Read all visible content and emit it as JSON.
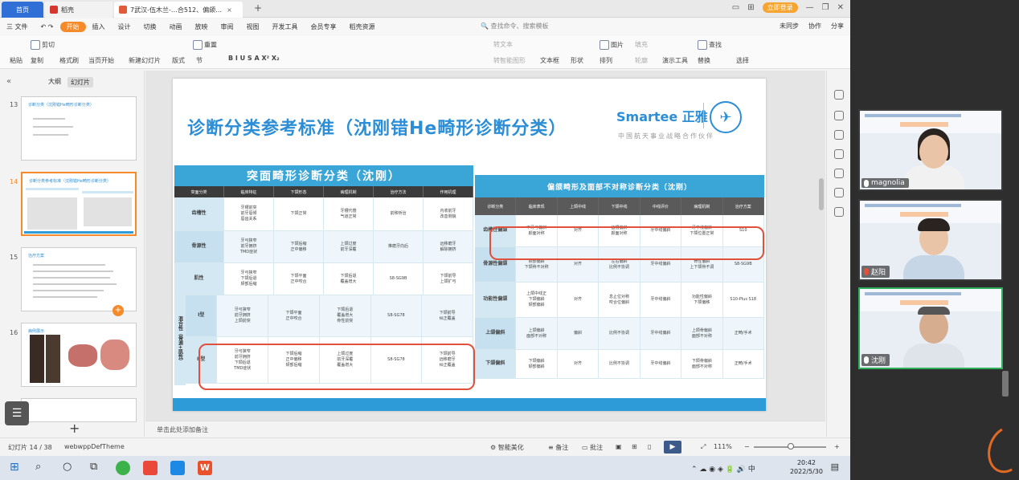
{
  "titlebar": {
    "home_tab": "首页",
    "tab2": "稻壳",
    "tab3": "7武汉-伍木兰-…合512、偏颌…",
    "login": "立即登录"
  },
  "menu": {
    "file": "三 文件",
    "items": [
      "开始",
      "插入",
      "设计",
      "切换",
      "动画",
      "放映",
      "审阅",
      "视图",
      "开发工具",
      "会员专享",
      "稻壳资源"
    ],
    "search": "查找命令、搜索模板",
    "right": [
      "未同步",
      "协作",
      "分享"
    ]
  },
  "ribbon": {
    "paste": "粘贴",
    "cut": "剪切",
    "copy": "复制",
    "format_painter": "格式刷",
    "from_start": "当页开始",
    "new_slide": "新建幻灯片",
    "layout": "版式",
    "section": "节",
    "reset": "重置",
    "textbox": "文本框",
    "shape": "形状",
    "arrange": "排列",
    "outline": "轮廓",
    "picture": "图片",
    "fill": "填充",
    "slideshow": "演示工具",
    "find": "查找",
    "replace": "替换",
    "select": "选择",
    "convert": "转智能图形",
    "text_to": "转文本"
  },
  "leftpanel": {
    "tab_outline": "大纲",
    "tab_slides": "幻灯片",
    "slides": [
      {
        "num": "13",
        "title": "诊断分类（沈刚错He畸形诊断分类）"
      },
      {
        "num": "14",
        "title": "诊断分类参考标准（沈刚错He畸形诊断分类）"
      },
      {
        "num": "15",
        "title": "治疗方案"
      },
      {
        "num": "16",
        "title": "病例展示"
      }
    ]
  },
  "slide": {
    "title": "诊断分类参考标准（沈刚错He畸形诊断分类）",
    "brand": "Smartee 正雅",
    "brand_sub": "中国航天事业战略合作伙伴",
    "left_table_title": "突面畸形诊断分类（沈刚）",
    "left_cols": [
      "突面分类",
      "临床特征",
      "下颌形态",
      "病理机制",
      "治疗方法",
      "作用机理"
    ],
    "left_rows": [
      "齿槽性",
      "骨源性",
      "肌性",
      "I型",
      "II型"
    ],
    "left_group_label": "混合性（骨源+肌性）",
    "right_table_title": "偏颌畸形及面部不对称诊断分类（沈刚）",
    "right_cols": [
      "诊断分类",
      "临床表现",
      "上颌中线",
      "下颌中线",
      "中线评价",
      "病理机制",
      "治疗方案"
    ],
    "right_rows": [
      "齿槽性偏颌",
      "骨源性偏颌",
      "功能性偏颌",
      "上颌偏斜",
      "下颌偏斜"
    ],
    "right_cells": {
      "r1_treat": "S10",
      "r2_treat": "S8-SG9B",
      "r3_treat": "S10-Plus S18",
      "r4_treat": "正畸/手术",
      "r5_treat": "正畸/手术"
    },
    "left_treat": [
      "前移矫治",
      "推磨牙向后",
      "S8-SG9B",
      "S8-SG78",
      "S8-SG78"
    ]
  },
  "notes": "单击此处添加备注",
  "status": {
    "slide_pos": "幻灯片 14 / 38",
    "theme": "webwppDefTheme",
    "smart": "智能美化",
    "notes_btn": "备注",
    "comment": "批注",
    "zoom": "111%"
  },
  "taskbar": {
    "time": "20:42",
    "date": "2022/5/30",
    "ime": "中"
  },
  "video": {
    "participants": [
      "magnolia",
      "赵阳",
      "沈刚"
    ]
  }
}
